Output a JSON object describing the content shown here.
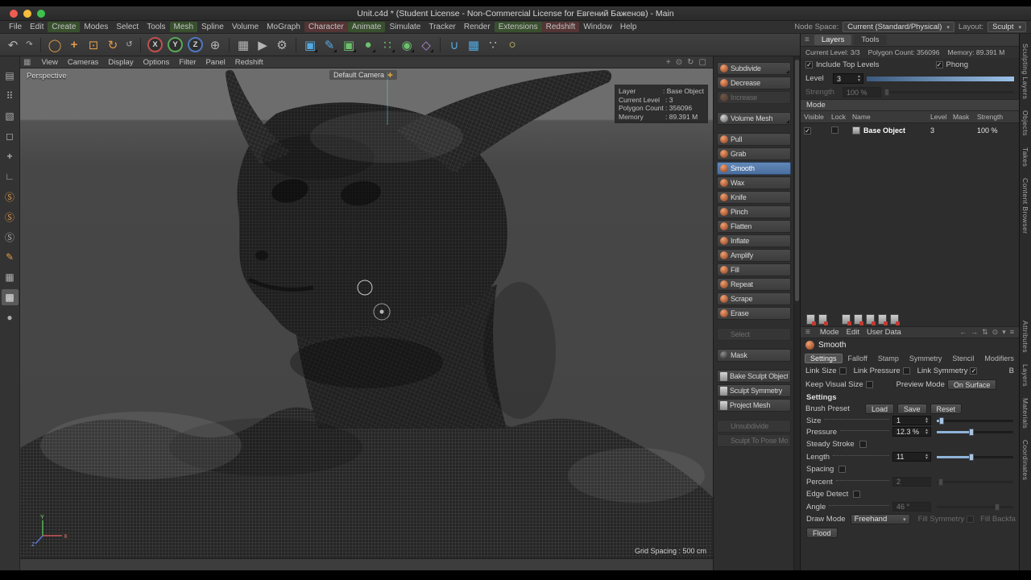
{
  "window": {
    "title": "Unit.c4d * (Student License - Non-Commercial License for Евгений Баженов) - Main"
  },
  "menu_bar": {
    "items": [
      {
        "label": "File"
      },
      {
        "label": "Edit"
      },
      {
        "label": "Create",
        "cls": "tint-green"
      },
      {
        "label": "Modes"
      },
      {
        "label": "Select"
      },
      {
        "label": "Tools"
      },
      {
        "label": "Mesh",
        "cls": "tint-green"
      },
      {
        "label": "Spline"
      },
      {
        "label": "Volume"
      },
      {
        "label": "MoGraph"
      },
      {
        "label": "Character",
        "cls": "tint-red"
      },
      {
        "label": "Animate",
        "cls": "tint-green"
      },
      {
        "label": "Simulate"
      },
      {
        "label": "Tracker"
      },
      {
        "label": "Render"
      },
      {
        "label": "Extensions",
        "cls": "tint-green"
      },
      {
        "label": "Redshift",
        "cls": "tint-red"
      },
      {
        "label": "Window"
      },
      {
        "label": "Help"
      }
    ],
    "node_space_label": "Node Space:",
    "node_space_value": "Current (Standard/Physical)",
    "layout_label": "Layout:",
    "layout_value": "Sculpt"
  },
  "toolbar": {
    "icons": [
      {
        "name": "undo-icon",
        "glyph": "↶",
        "cls": "big"
      },
      {
        "name": "redo-icon",
        "glyph": "↷",
        "cls": "small"
      },
      {
        "name": "separator",
        "cls": "sep"
      },
      {
        "name": "live-selection-icon",
        "glyph": "◯",
        "cls": "big orange"
      },
      {
        "name": "move-tool-icon",
        "glyph": "+",
        "cls": "big orange bold"
      },
      {
        "name": "scale-tool-icon",
        "glyph": "⊡",
        "cls": "big orange"
      },
      {
        "name": "rotate-tool-icon",
        "glyph": "↻",
        "cls": "big orange"
      },
      {
        "name": "last-tool-icon",
        "glyph": "↺",
        "cls": "small"
      },
      {
        "name": "separator",
        "cls": "sep"
      },
      {
        "name": "x-axis-lock-button",
        "glyph": "X",
        "cls": "axis ax-x"
      },
      {
        "name": "y-axis-lock-button",
        "glyph": "Y",
        "cls": "axis ax-y"
      },
      {
        "name": "z-axis-lock-button",
        "glyph": "Z",
        "cls": "axis ax-z"
      },
      {
        "name": "coordinate-system-icon",
        "glyph": "⊕",
        "cls": "big"
      },
      {
        "name": "separator",
        "cls": "sep"
      },
      {
        "name": "render-view-icon",
        "glyph": "▦",
        "cls": "big"
      },
      {
        "name": "render-picture-viewer-icon",
        "glyph": "▶",
        "cls": "big"
      },
      {
        "name": "render-settings-icon",
        "glyph": "⚙",
        "cls": "big"
      },
      {
        "name": "separator",
        "cls": "sep"
      },
      {
        "name": "subdivision-surface-icon",
        "glyph": "▣",
        "cls": "big blue corner"
      },
      {
        "name": "spline-pen-icon",
        "glyph": "✎",
        "cls": "big blue corner"
      },
      {
        "name": "primitive-cube-icon",
        "glyph": "▣",
        "cls": "big green corner"
      },
      {
        "name": "volume-builder-icon",
        "glyph": "●",
        "cls": "big green corner"
      },
      {
        "name": "mograph-cloner-icon",
        "glyph": "∷",
        "cls": "big green corner"
      },
      {
        "name": "field-icon",
        "glyph": "◉",
        "cls": "big green corner"
      },
      {
        "name": "deformer-icon",
        "glyph": "◇",
        "cls": "big purple corner"
      },
      {
        "name": "separator",
        "cls": "sep"
      },
      {
        "name": "snap-icon",
        "glyph": "∪",
        "cls": "big blue"
      },
      {
        "name": "grid-snap-icon",
        "glyph": "▦",
        "cls": "big blue"
      },
      {
        "name": "dots-icon",
        "glyph": "∵",
        "cls": "big"
      },
      {
        "name": "light-icon",
        "glyph": "○",
        "cls": "big yellow"
      }
    ]
  },
  "left_toolbar": {
    "icons": [
      {
        "name": "undo-history-icon",
        "glyph": "▤"
      },
      {
        "name": "mesh-check-icon",
        "glyph": "⠿"
      },
      {
        "name": "modeling-mode-icon",
        "glyph": "▧"
      },
      {
        "name": "workplane-icon",
        "glyph": "◻"
      },
      {
        "name": "axis-mode-icon",
        "glyph": "+",
        "cls": "bold"
      },
      {
        "name": "corner-snap-icon",
        "glyph": "∟"
      },
      {
        "name": "sculpt-layers-icon",
        "glyph": "Ⓢ",
        "cls": "orange"
      },
      {
        "name": "sculpt-masks-icon",
        "glyph": "Ⓢ",
        "cls": "orange"
      },
      {
        "name": "sculpt-objects-icon",
        "glyph": "Ⓢ"
      },
      {
        "name": "paint-brush-icon",
        "glyph": "✎",
        "cls": "orange"
      },
      {
        "name": "uv-mesh-icon",
        "glyph": "▦"
      },
      {
        "name": "wireframe-mode-icon",
        "glyph": "▩",
        "cls": "sel"
      },
      {
        "name": "sphere-preview-icon",
        "glyph": "●"
      }
    ]
  },
  "viewport": {
    "menus": [
      {
        "label": "View"
      },
      {
        "label": "Cameras"
      },
      {
        "label": "Display"
      },
      {
        "label": "Options"
      },
      {
        "label": "Filter"
      },
      {
        "label": "Panel"
      },
      {
        "label": "Redshift"
      }
    ],
    "corner_icons": [
      {
        "name": "pan-view-icon",
        "glyph": "+"
      },
      {
        "name": "zoom-view-icon",
        "glyph": "⊙"
      },
      {
        "name": "rotate-view-icon",
        "glyph": "↻"
      },
      {
        "name": "toggle-view-icon",
        "glyph": "▢"
      }
    ],
    "view_label": "Perspective",
    "camera_label": "Default Camera",
    "info_rows": [
      {
        "label": "Layer",
        "value": "Base Object"
      },
      {
        "label": "Current Level",
        "value": "3"
      },
      {
        "label": "Polygon Count",
        "value": "356096"
      },
      {
        "label": "Memory",
        "value": "89.391 M"
      }
    ],
    "grid_spacing": "Grid Spacing : 500 cm",
    "gizmo": {
      "x": "X",
      "y": "Y",
      "z": "Z"
    }
  },
  "sculpt_panel": {
    "buttons": [
      {
        "label": "Subdivide",
        "icon": "orange",
        "cls": "corner"
      },
      {
        "label": "Decrease",
        "icon": "orange"
      },
      {
        "label": "Increase",
        "icon": "orange",
        "cls": "disabled"
      },
      {
        "label": "Volume Mesh",
        "icon": "gray",
        "cls": "gap corner"
      },
      {
        "label": "Pull",
        "icon": "orange",
        "cls": "gap"
      },
      {
        "label": "Grab",
        "icon": "orange"
      },
      {
        "label": "Smooth",
        "icon": "orange",
        "cls": "selected"
      },
      {
        "label": "Wax",
        "icon": "orange"
      },
      {
        "label": "Knife",
        "icon": "orange"
      },
      {
        "label": "Pinch",
        "icon": "orange"
      },
      {
        "label": "Flatten",
        "icon": "orange"
      },
      {
        "label": "Inflate",
        "icon": "orange"
      },
      {
        "label": "Amplify",
        "icon": "orange"
      },
      {
        "label": "Fill",
        "icon": "orange"
      },
      {
        "label": "Repeat",
        "icon": "orange"
      },
      {
        "label": "Scrape",
        "icon": "orange"
      },
      {
        "label": "Erase",
        "icon": "orange"
      },
      {
        "label": "Select",
        "icon": "none",
        "cls": "gap disabled"
      },
      {
        "label": "Mask",
        "icon": "dark",
        "cls": "gap"
      },
      {
        "label": "Bake Sculpt Objects",
        "icon": "doc",
        "cls": "gap"
      },
      {
        "label": "Sculpt Symmetry",
        "icon": "doc"
      },
      {
        "label": "Project Mesh",
        "icon": "doc"
      },
      {
        "label": "Unsubdivide",
        "icon": "none",
        "cls": "gap disabled"
      },
      {
        "label": "Sculpt To Pose Morph",
        "icon": "none",
        "cls": "disabled"
      }
    ]
  },
  "right_panel": {
    "tabs": [
      {
        "label": "Layers",
        "cls": "active"
      },
      {
        "label": "Tools"
      }
    ],
    "stats": [
      "Current Level: 3/3",
      "Polygon Count: 356096",
      "Memory: 89.391 M"
    ],
    "include_top_levels_label": "Include Top Levels",
    "phong_label": "Phong",
    "level_label": "Level",
    "level_value": "3",
    "strength_label": "Strength",
    "strength_value": "100 %",
    "mode_header": "Mode",
    "table": {
      "headers": [
        "Visible",
        "Lock",
        "Name",
        "Level",
        "Mask",
        "Strength"
      ],
      "row": {
        "name": "Base Object",
        "level": "3",
        "mask": "",
        "strength": "100 %"
      }
    },
    "layer_icons": [
      {
        "name": "add-layer-icon",
        "cls": "c-red"
      },
      {
        "name": "add-folder-icon",
        "cls": "c-red"
      },
      {
        "name": "delete-layer-icon",
        "cls": "c-red gap"
      },
      {
        "name": "duplicate-layer-icon",
        "cls": "c-red"
      },
      {
        "name": "merge-layer-icon",
        "cls": "c-red"
      },
      {
        "name": "mask-layer-icon",
        "cls": "c-red"
      },
      {
        "name": "invert-mask-icon",
        "cls": "c-red"
      }
    ],
    "menu_row": [
      {
        "label": "Mode"
      },
      {
        "label": "Edit"
      },
      {
        "label": "User Data"
      }
    ],
    "menu_row_icons": [
      {
        "name": "back-arrow-icon",
        "glyph": "←"
      },
      {
        "name": "forward-arrow-icon",
        "glyph": "→"
      },
      {
        "name": "swap-icon",
        "glyph": "⇅"
      },
      {
        "name": "search-icon",
        "glyph": "⊙"
      },
      {
        "name": "filter-icon",
        "glyph": "▾"
      },
      {
        "name": "list-icon",
        "glyph": "≡"
      }
    ],
    "tool_title": "Smooth",
    "tool_tabs": [
      {
        "label": "Settings",
        "cls": "active"
      },
      {
        "label": "Falloff"
      },
      {
        "label": "Stamp"
      },
      {
        "label": "Symmetry"
      },
      {
        "label": "Stencil"
      },
      {
        "label": "Modifiers"
      }
    ],
    "link_size_label": "Link Size",
    "link_pressure_label": "Link Pressure",
    "link_symmetry_label": "Link Symmetry",
    "link_overflow_label": "B",
    "keep_visual_size_label": "Keep Visual Size",
    "preview_mode_label": "Preview Mode",
    "preview_mode_value": "On Surface",
    "settings_header": "Settings",
    "brush_preset_label": "Brush Preset",
    "load_button": "Load",
    "save_button": "Save",
    "reset_button": "Reset",
    "size_label": "Size",
    "size_value": "1",
    "pressure_label": "Pressure",
    "pressure_value": "12.3 %",
    "steady_stroke_label": "Steady Stroke",
    "length_label": "Length",
    "length_value": "11",
    "spacing_label": "Spacing",
    "percent_label": "Percent",
    "percent_value": "2",
    "edge_detect_label": "Edge Detect",
    "angle_label": "Angle",
    "angle_value": "46 °",
    "draw_mode_label": "Draw Mode",
    "draw_mode_value": "Freehand",
    "fill_symmetry_label": "Fill Symmetry",
    "fill_backface_label": "Fill Backfa",
    "flood_button": "Flood"
  },
  "side_tabs": {
    "top": [
      "Sculpting Layers",
      "Objects",
      "Takes",
      "Content Browser"
    ],
    "bottom": [
      "Attributes",
      "Layers",
      "Materials",
      "Coordinates"
    ]
  }
}
